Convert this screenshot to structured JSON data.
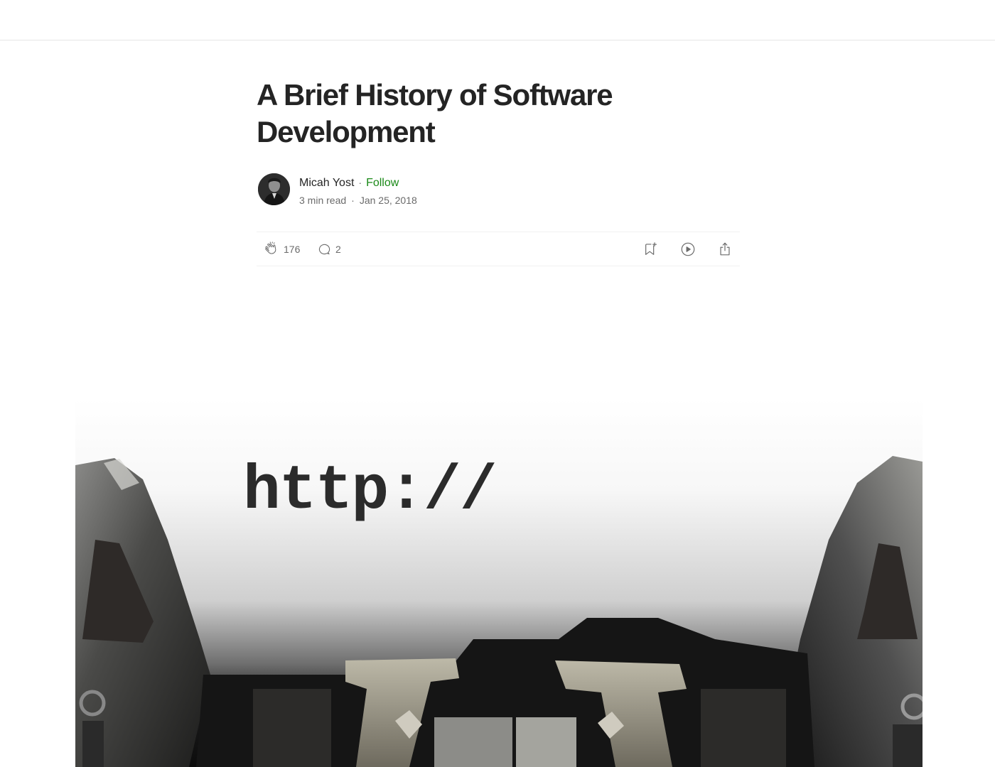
{
  "article": {
    "title": "A Brief History of Software Development",
    "author": {
      "name": "Micah Yost",
      "follow_label": "Follow",
      "separator": "·"
    },
    "meta": {
      "read_time": "3 min read",
      "date": "Jan 25, 2018",
      "separator": "·"
    },
    "actions": {
      "claps": "176",
      "responses": "2",
      "icons": [
        "clap-icon",
        "comment-icon",
        "bookmark-add-icon",
        "listen-play-icon",
        "share-icon"
      ]
    },
    "hero_image": {
      "typed_text": "http://",
      "description_icon": "typewriter-photo"
    }
  },
  "colors": {
    "text": "#242424",
    "muted": "#6b6b6b",
    "follow": "#1a8917",
    "divider": "#f2f2f2"
  }
}
